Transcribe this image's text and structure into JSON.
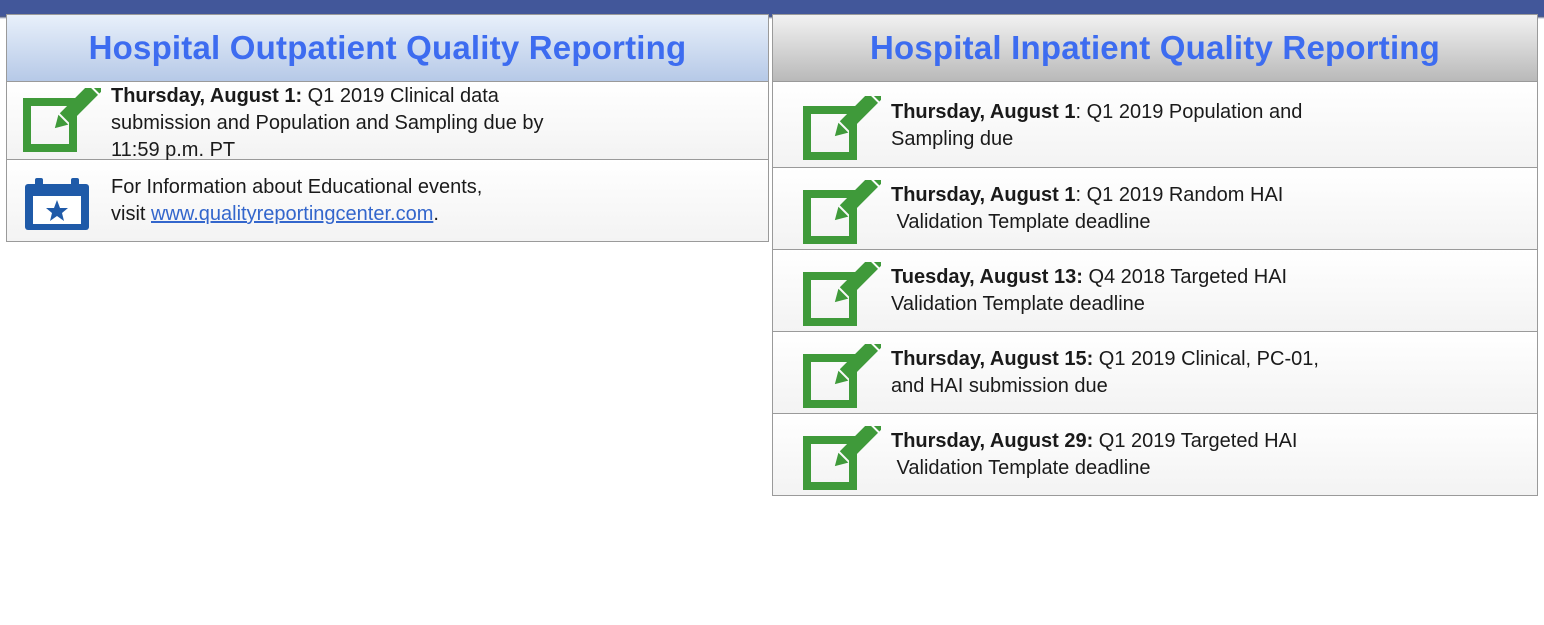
{
  "outpatient": {
    "title": "Hospital Outpatient Quality Reporting",
    "items": [
      {
        "icon": "edit-check-icon",
        "date": "Thursday, August 1:",
        "text_line1": " Q1 2019 Clinical data",
        "text_line2": "submission and Population and Sampling due by",
        "text_line3": "11:59 p.m. PT"
      },
      {
        "icon": "calendar-star-icon",
        "text_line1": "For Information about Educational events,",
        "visit_prefix": "visit ",
        "link": "www.qualityreportingcenter.com",
        "suffix": "."
      }
    ]
  },
  "inpatient": {
    "title": "Hospital Inpatient Quality Reporting",
    "items": [
      {
        "icon": "edit-check-icon",
        "date": "Thursday, August 1",
        "line1": ": Q1 2019 Population and",
        "line2": "Sampling due"
      },
      {
        "icon": "edit-check-icon",
        "date": "Thursday, August 1",
        "line1": ": Q1 2019 Random HAI",
        "line2": " Validation Template deadline"
      },
      {
        "icon": "edit-check-icon",
        "date": "Tuesday, August 13:",
        "line1": " Q4 2018 Targeted HAI",
        "line2": "Validation Template deadline"
      },
      {
        "icon": "edit-check-icon",
        "date": "Thursday, August 15:",
        "line1": " Q1 2019 Clinical, PC-01,",
        "line2": "and HAI submission due"
      },
      {
        "icon": "edit-check-icon",
        "date": "Thursday, August 29:",
        "line1": " Q1 2019 Targeted HAI",
        "line2": " Validation Template deadline"
      }
    ]
  },
  "colors": {
    "band": "#42579a",
    "title": "#3d6cf0",
    "icon_green": "#3f9a3a",
    "icon_blue": "#1f5aa8",
    "link": "#3366cc"
  }
}
